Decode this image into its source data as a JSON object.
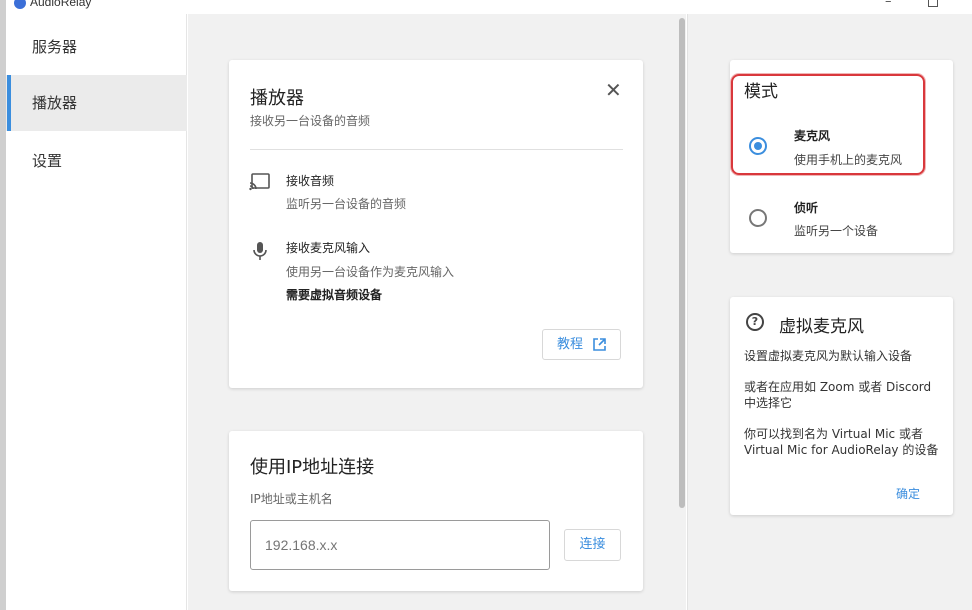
{
  "window": {
    "title": "AudioRelay",
    "minimize": "–",
    "maximize": ""
  },
  "sidebar": {
    "items": [
      {
        "label": "服务器"
      },
      {
        "label": "播放器"
      },
      {
        "label": "设置"
      }
    ],
    "active_index": 1
  },
  "player_card": {
    "title": "播放器",
    "subtitle": "接收另一台设备的音频",
    "close_icon": "close-icon",
    "options": [
      {
        "icon": "cast-icon",
        "title": "接收音频",
        "desc": "监听另一台设备的音频"
      },
      {
        "icon": "microphone-icon",
        "title": "接收麦克风输入",
        "desc": "使用另一台设备作为麦克风输入",
        "note": "需要虚拟音频设备"
      }
    ],
    "tutorial_button": "教程"
  },
  "ip_card": {
    "title": "使用IP地址连接",
    "label": "IP地址或主机名",
    "input_placeholder": "192.168.x.x",
    "connect_button": "连接"
  },
  "mode_card": {
    "title": "模式",
    "options": [
      {
        "title": "麦克风",
        "desc": "使用手机上的麦克风",
        "selected": true
      },
      {
        "title": "侦听",
        "desc": "监听另一个设备",
        "selected": false
      }
    ]
  },
  "virtual_mic_card": {
    "icon": "help-icon",
    "title": "虚拟麦克风",
    "lines": [
      "设置虚拟麦克风为默认输入设备",
      "或者在应用如 Zoom 或者 Discord 中选择它",
      "你可以找到名为 Virtual Mic 或者 Virtual Mic for AudioRelay 的设备"
    ],
    "ok_button": "确定"
  },
  "colors": {
    "accent": "#3b8ede",
    "highlight_border": "#d9383c"
  }
}
